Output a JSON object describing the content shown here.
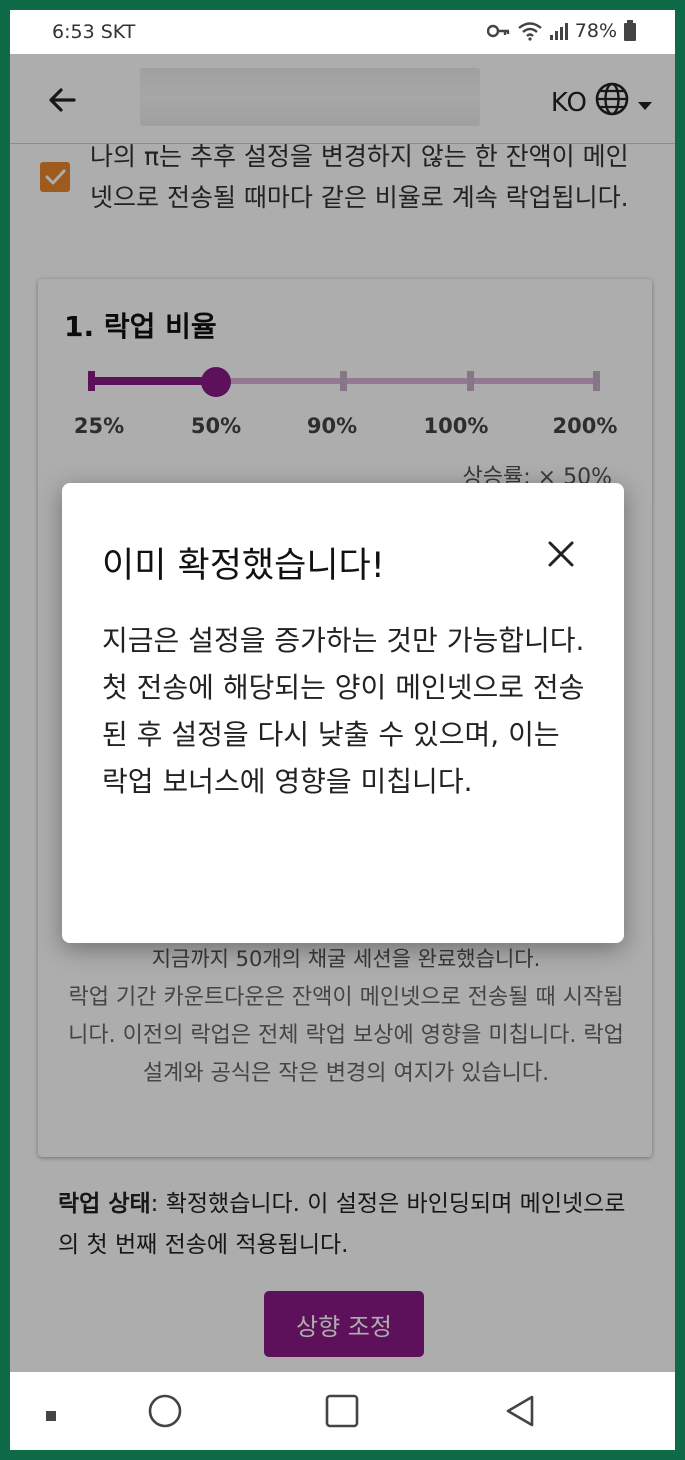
{
  "status_bar": {
    "time": "6:53 SKT",
    "battery": "78%"
  },
  "app_bar": {
    "language": "KO"
  },
  "checkbox_text": "나의 π는 추후 설정을 변경하지 않는 한 잔액이 메인넷으로 전송될 때마다 같은 비율로 계속 락업됩니다.",
  "card": {
    "title": "1. 락업 비율",
    "slider": {
      "labels": [
        "25%",
        "50%",
        "90%",
        "100%",
        "200%"
      ],
      "selected_index": 1
    },
    "rate_text": "상승률: × 50%",
    "partial_line": "지금까지 50개의 채굴 세션을 완료했습니다.",
    "countdown_text": "락업 기간 카운트다운은 잔액이 메인넷으로 전송될 때 시작됩니다. 이전의 락업은 전체 락업 보상에 영향을 미칩니다. 락업 설계와 공식은 작은 변경의 여지가 있습니다."
  },
  "lockup_status": {
    "label": "락업 상태",
    "text": ": 확정했습니다. 이 설정은 바인딩되며 메인넷으로의 첫 번째 전송에 적용됩니다."
  },
  "adjust_button": "상향 조정",
  "dialog": {
    "title": "이미 확정했습니다!",
    "body": "지금은 설정을 증가하는 것만 가능합니다. 첫 전송에 해당되는 양이 메인넷으로 전송된 후 설정을 다시 낮출 수 있으며, 이는 락업 보너스에 영향을 미칩니다."
  },
  "colors": {
    "accent": "#8a1a87",
    "checkbox": "#e8862c",
    "frame": "#0f6b47"
  }
}
